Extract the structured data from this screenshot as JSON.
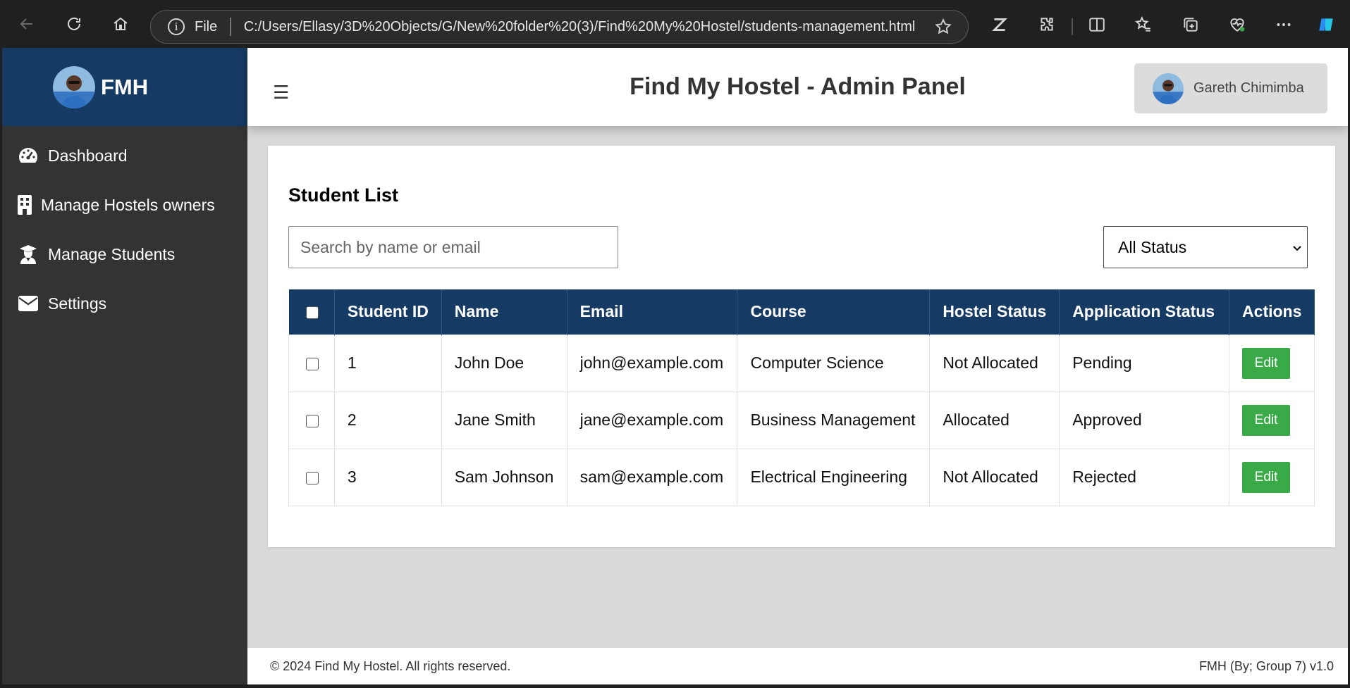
{
  "browser": {
    "file_label": "File",
    "url": "C:/Users/Ellasy/3D%20Objects/G/New%20folder%20(3)/Find%20My%20Hostel/students-management.html"
  },
  "sidebar": {
    "brand": "FMH",
    "items": [
      {
        "label": "Dashboard",
        "icon": "gauge-icon"
      },
      {
        "label": "Manage Hostels owners",
        "icon": "building-icon"
      },
      {
        "label": "Manage Students",
        "icon": "graduate-icon"
      },
      {
        "label": "Settings",
        "icon": "envelope-icon"
      }
    ]
  },
  "header": {
    "menu_glyph": "☰",
    "title": "Find My Hostel - Admin Panel",
    "user_name": "Gareth Chimimba"
  },
  "students": {
    "title": "Student List",
    "search_placeholder": "Search by name or email",
    "status_filter": "All Status",
    "columns": [
      "Student ID",
      "Name",
      "Email",
      "Course",
      "Hostel Status",
      "Application Status",
      "Actions"
    ],
    "rows": [
      {
        "id": "1",
        "name": "John Doe",
        "email": "john@example.com",
        "course": "Computer Science",
        "hostel_status": "Not Allocated",
        "application_status": "Pending",
        "action": "Edit"
      },
      {
        "id": "2",
        "name": "Jane Smith",
        "email": "jane@example.com",
        "course": "Business Management",
        "hostel_status": "Allocated",
        "application_status": "Approved",
        "action": "Edit"
      },
      {
        "id": "3",
        "name": "Sam Johnson",
        "email": "sam@example.com",
        "course": "Electrical Engineering",
        "hostel_status": "Not Allocated",
        "application_status": "Rejected",
        "action": "Edit"
      }
    ]
  },
  "footer": {
    "copyright": "© 2024 Find My Hostel. All rights reserved.",
    "version": "FMH (By; Group 7) v1.0"
  },
  "colors": {
    "brand_blue": "#153a63",
    "sidebar_bg": "#333333",
    "edit_green": "#3aaa48"
  }
}
